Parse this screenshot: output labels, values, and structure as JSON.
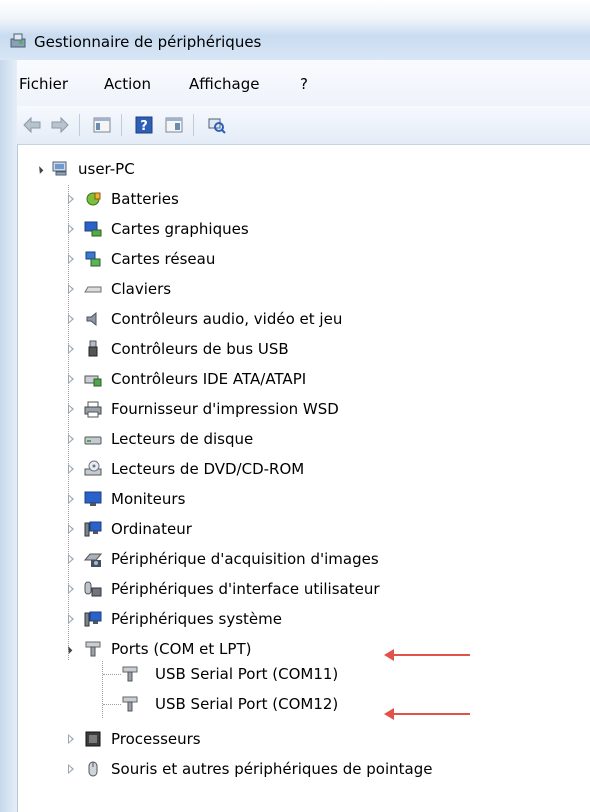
{
  "window": {
    "title": "Gestionnaire de périphériques"
  },
  "menu": [
    "Fichier",
    "Action",
    "Affichage",
    "?"
  ],
  "toolbar": {
    "icons": [
      "back-icon",
      "forward-icon",
      "show-hide-console-tree-icon",
      "help-icon",
      "properties-icon",
      "scan-hardware-icon"
    ]
  },
  "tree": {
    "root": "user-PC",
    "categories": [
      "Batteries",
      "Cartes graphiques",
      "Cartes réseau",
      "Claviers",
      "Contrôleurs audio, vidéo et jeu",
      "Contrôleurs de bus USB",
      "Contrôleurs IDE ATA/ATAPI",
      "Fournisseur d'impression WSD",
      "Lecteurs de disque",
      "Lecteurs de DVD/CD-ROM",
      "Moniteurs",
      "Ordinateur",
      "Périphérique d'acquisition d'images",
      "Périphériques d'interface utilisateur",
      "Périphériques système",
      "Ports (COM et LPT)",
      "Processeurs",
      "Souris et autres périphériques de pointage"
    ],
    "ports_children": [
      "USB Serial Port (COM11)",
      "USB Serial Port (COM12)"
    ]
  },
  "colors": {
    "annotation_arrow": "#e0524a"
  }
}
